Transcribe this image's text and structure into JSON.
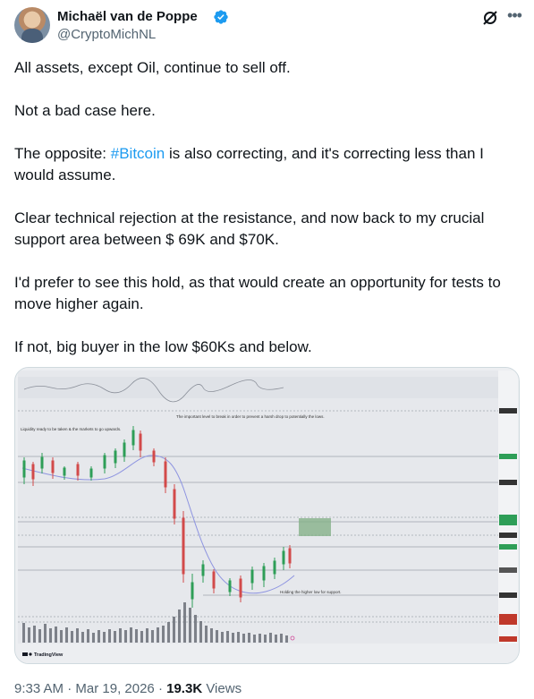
{
  "author": {
    "name": "Michaël van de Poppe",
    "handle": "@CryptoMichNL",
    "avatar_icon": "avatar-photo",
    "verified_color": "#1d9bf0"
  },
  "tweet": {
    "p1": "All assets, except Oil, continue to sell off.",
    "p2": "Not a bad case here.",
    "p3_pre": "The opposite: ",
    "p3_tag": "#Bitcoin",
    "p3_post": " is also correcting, and it's correcting less than I would assume.",
    "p4": "Clear technical rejection at the resistance, and now back to my crucial support area between $ 69K and $70K.",
    "p5": "I'd prefer to see this hold, as that would create an opportunity for tests to move higher again.",
    "p6": "If not, big buyer in the low $60Ks and below.",
    "hashtag_color": "#1d9bf0"
  },
  "chart": {
    "annotation_top": "The important level to break in order to prevent a harsh drop to potentially the lows.",
    "annotation_left": "Liquidity ready to be taken & the markets to go upwards.",
    "annotation_bottom": "Holding the higher low for support.",
    "watermark": "TradingView"
  },
  "meta": {
    "time": "9:33 AM",
    "sep1": " · ",
    "date": "Mar 19, 2026",
    "sep2": " · ",
    "views_count": "19.3K",
    "views_label": " Views"
  }
}
